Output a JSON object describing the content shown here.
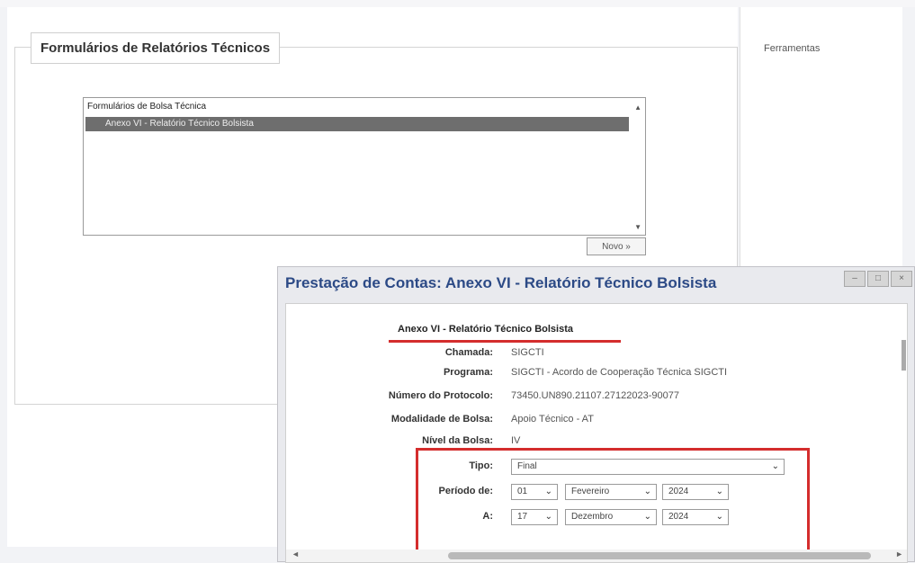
{
  "main": {
    "section_title": "Formulários de Relatórios Técnicos",
    "list_group": "Formulários de Bolsa Técnica",
    "list_option": "Anexo VI - Relatório Técnico Bolsista",
    "novo_button": "Novo »"
  },
  "sidebar": {
    "title": "Ferramentas"
  },
  "dialog": {
    "title": "Prestação de Contas: Anexo VI - Relatório Técnico Bolsista",
    "heading": "Anexo VI - Relatório Técnico Bolsista",
    "fields": {
      "chamada": {
        "label": "Chamada:",
        "value": "SIGCTI"
      },
      "programa": {
        "label": "Programa:",
        "value": "SIGCTI - Acordo de Cooperação Técnica SIGCTI"
      },
      "protocolo": {
        "label": "Número do Protocolo:",
        "value": "73450.UN890.21107.27122023-90077"
      },
      "modalidade": {
        "label": "Modalidade de Bolsa:",
        "value": "Apoio Técnico - AT"
      },
      "nivel": {
        "label": "Nível da Bolsa:",
        "value": "IV"
      }
    },
    "tipo": {
      "label": "Tipo:",
      "value": "Final"
    },
    "periodo_de": {
      "label": "Período de:",
      "day": "01",
      "month": "Fevereiro",
      "year": "2024"
    },
    "periodo_a": {
      "label": "A:",
      "day": "17",
      "month": "Dezembro",
      "year": "2024"
    }
  },
  "colors": {
    "highlight_red": "#d42d2d",
    "title_blue": "#2c4a86"
  }
}
